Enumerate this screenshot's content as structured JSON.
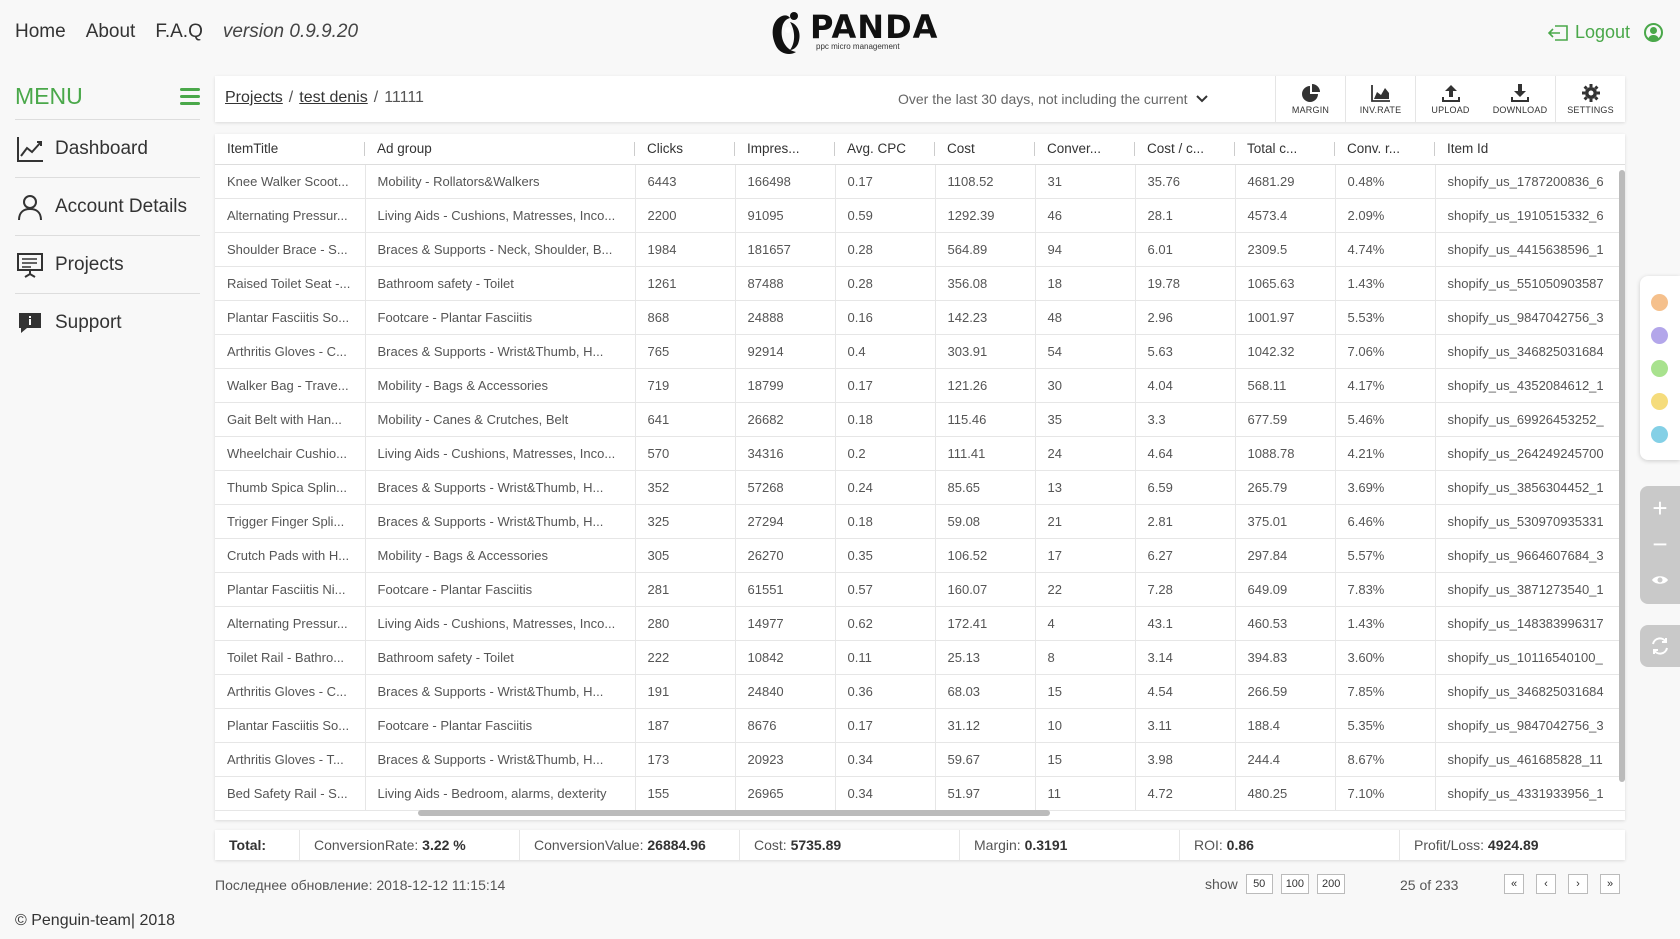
{
  "topnav": {
    "home": "Home",
    "about": "About",
    "faq": "F.A.Q",
    "version": "version 0.9.9.20"
  },
  "logo": {
    "name": "PANDA",
    "tagline": "ppc micro management"
  },
  "header": {
    "logout": "Logout"
  },
  "sidebar": {
    "title": "MENU",
    "items": [
      {
        "label": "Dashboard",
        "icon": "chart-line-icon"
      },
      {
        "label": "Account Details",
        "icon": "user-icon"
      },
      {
        "label": "Projects",
        "icon": "presentation-icon"
      },
      {
        "label": "Support",
        "icon": "chat-icon"
      }
    ]
  },
  "breadcrumb": {
    "root": "Projects",
    "project": "test denis",
    "current": "11111",
    "sep": "/"
  },
  "period": "Over the last 30 days, not including the current",
  "toolbar": {
    "margin": "MARGIN",
    "inv_rate": "INV.RATE",
    "upload": "UPLOAD",
    "download": "DOWNLOAD",
    "settings": "SETTINGS"
  },
  "table": {
    "columns": [
      "ItemTitle",
      "Ad group",
      "Clicks",
      "Impres...",
      "Avg. CPC",
      "Cost",
      "Conver...",
      "Cost / c...",
      "Total c...",
      "Conv. r...",
      "Item Id"
    ],
    "rows": [
      [
        "Knee Walker Scoot...",
        "Mobility - Rollators&Walkers",
        "6443",
        "166498",
        "0.17",
        "1108.52",
        "31",
        "35.76",
        "4681.29",
        "0.48%",
        "shopify_us_1787200836_6"
      ],
      [
        "Alternating Pressur...",
        "Living Aids - Cushions, Matresses, Inco...",
        "2200",
        "91095",
        "0.59",
        "1292.39",
        "46",
        "28.1",
        "4573.4",
        "2.09%",
        "shopify_us_1910515332_6"
      ],
      [
        "Shoulder Brace - S...",
        "Braces & Supports - Neck, Shoulder, B...",
        "1984",
        "181657",
        "0.28",
        "564.89",
        "94",
        "6.01",
        "2309.5",
        "4.74%",
        "shopify_us_4415638596_1"
      ],
      [
        "Raised Toilet Seat -...",
        "Bathroom safety - Toilet",
        "1261",
        "87488",
        "0.28",
        "356.08",
        "18",
        "19.78",
        "1065.63",
        "1.43%",
        "shopify_us_551050903587"
      ],
      [
        "Plantar Fasciitis So...",
        "Footcare - Plantar Fasciitis",
        "868",
        "24888",
        "0.16",
        "142.23",
        "48",
        "2.96",
        "1001.97",
        "5.53%",
        "shopify_us_9847042756_3"
      ],
      [
        "Arthritis Gloves - C...",
        "Braces & Supports - Wrist&Thumb, H...",
        "765",
        "92914",
        "0.4",
        "303.91",
        "54",
        "5.63",
        "1042.32",
        "7.06%",
        "shopify_us_346825031684"
      ],
      [
        "Walker Bag - Trave...",
        "Mobility - Bags & Accessories",
        "719",
        "18799",
        "0.17",
        "121.26",
        "30",
        "4.04",
        "568.11",
        "4.17%",
        "shopify_us_4352084612_1"
      ],
      [
        "Gait Belt with Han...",
        "Mobility - Canes & Crutches, Belt",
        "641",
        "26682",
        "0.18",
        "115.46",
        "35",
        "3.3",
        "677.59",
        "5.46%",
        "shopify_us_69926453252_"
      ],
      [
        "Wheelchair Cushio...",
        "Living Aids - Cushions, Matresses, Inco...",
        "570",
        "34316",
        "0.2",
        "111.41",
        "24",
        "4.64",
        "1088.78",
        "4.21%",
        "shopify_us_264249245700"
      ],
      [
        "Thumb Spica Splin...",
        "Braces & Supports - Wrist&Thumb, H...",
        "352",
        "57268",
        "0.24",
        "85.65",
        "13",
        "6.59",
        "265.79",
        "3.69%",
        "shopify_us_3856304452_1"
      ],
      [
        "Trigger Finger Spli...",
        "Braces & Supports - Wrist&Thumb, H...",
        "325",
        "27294",
        "0.18",
        "59.08",
        "21",
        "2.81",
        "375.01",
        "6.46%",
        "shopify_us_530970935331"
      ],
      [
        "Crutch Pads with H...",
        "Mobility - Bags & Accessories",
        "305",
        "26270",
        "0.35",
        "106.52",
        "17",
        "6.27",
        "297.84",
        "5.57%",
        "shopify_us_9664607684_3"
      ],
      [
        "Plantar Fasciitis Ni...",
        "Footcare - Plantar Fasciitis",
        "281",
        "61551",
        "0.57",
        "160.07",
        "22",
        "7.28",
        "649.09",
        "7.83%",
        "shopify_us_3871273540_1"
      ],
      [
        "Alternating Pressur...",
        "Living Aids - Cushions, Matresses, Inco...",
        "280",
        "14977",
        "0.62",
        "172.41",
        "4",
        "43.1",
        "460.53",
        "1.43%",
        "shopify_us_148383996317"
      ],
      [
        "Toilet Rail - Bathro...",
        "Bathroom safety - Toilet",
        "222",
        "10842",
        "0.11",
        "25.13",
        "8",
        "3.14",
        "394.83",
        "3.60%",
        "shopify_us_10116540100_"
      ],
      [
        "Arthritis Gloves - C...",
        "Braces & Supports - Wrist&Thumb, H...",
        "191",
        "24840",
        "0.36",
        "68.03",
        "15",
        "4.54",
        "266.59",
        "7.85%",
        "shopify_us_346825031684"
      ],
      [
        "Plantar Fasciitis So...",
        "Footcare - Plantar Fasciitis",
        "187",
        "8676",
        "0.17",
        "31.12",
        "10",
        "3.11",
        "188.4",
        "5.35%",
        "shopify_us_9847042756_3"
      ],
      [
        "Arthritis Gloves - T...",
        "Braces & Supports - Wrist&Thumb, H...",
        "173",
        "20923",
        "0.34",
        "59.67",
        "15",
        "3.98",
        "244.4",
        "8.67%",
        "shopify_us_461685828_11"
      ],
      [
        "Bed Safety Rail - S...",
        "Living Aids - Bedroom, alarms, dexterity",
        "155",
        "26965",
        "0.34",
        "51.97",
        "11",
        "4.72",
        "480.25",
        "7.10%",
        "shopify_us_4331933956_1"
      ]
    ]
  },
  "totals": {
    "label": "Total:",
    "conversion_rate_label": "ConversionRate:",
    "conversion_rate": "3.22 %",
    "conversion_value_label": "ConversionValue:",
    "conversion_value": "26884.96",
    "cost_label": "Cost:",
    "cost": "5735.89",
    "margin_label": "Margin:",
    "margin": "0.3191",
    "roi_label": "ROI:",
    "roi": "0.86",
    "profit_label": "Profit/Loss:",
    "profit": "4924.89"
  },
  "footer": {
    "updated": "Последнее обновление: 2018-12-12 11:15:14",
    "show_label": "show",
    "page_sizes": [
      "50",
      "100",
      "200"
    ],
    "page_info": "25 of 233",
    "nav": {
      "first": "«",
      "prev": "‹",
      "next": "›",
      "last": "»"
    },
    "copyright": "© Penguin-team| 2018"
  },
  "palette": {
    "colors": [
      "#f5c08c",
      "#b3a6ea",
      "#a8e28e",
      "#f5dc7c",
      "#84d0e6"
    ]
  },
  "zoom": {
    "plus": "+",
    "minus": "−"
  },
  "colors": {
    "accent": "#4aa84a"
  }
}
